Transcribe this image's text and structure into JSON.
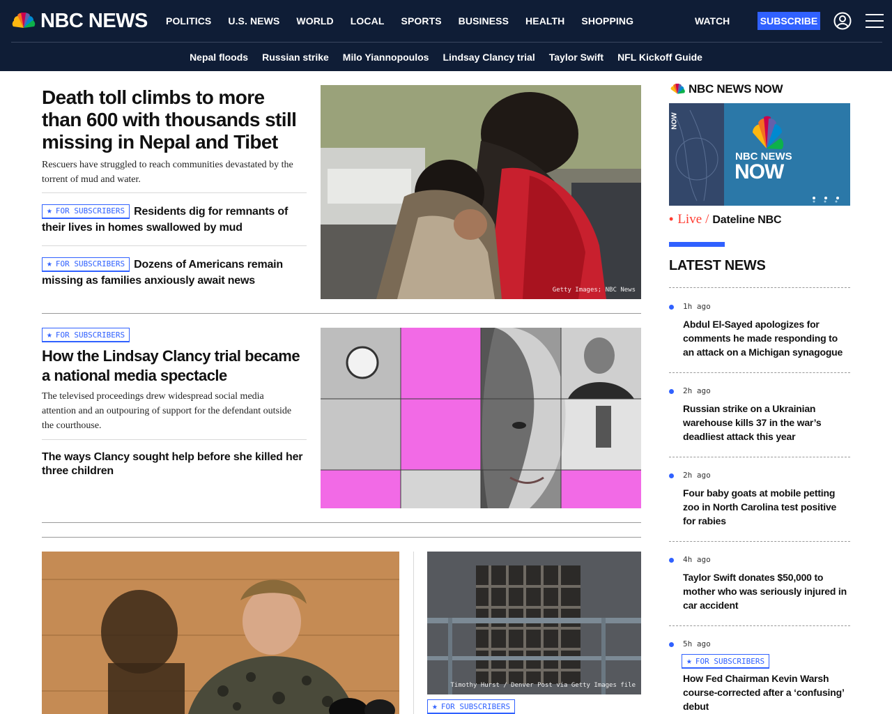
{
  "header": {
    "brand": "NBC NEWS",
    "nav": [
      "POLITICS",
      "U.S. NEWS",
      "WORLD",
      "LOCAL",
      "SPORTS",
      "BUSINESS",
      "HEALTH",
      "SHOPPING"
    ],
    "watch": "WATCH",
    "subscribe": "SUBSCRIBE",
    "trending": [
      "Nepal floods",
      "Russian strike",
      "Milo Yiannopoulos",
      "Lindsay Clancy trial",
      "Taylor Swift",
      "NFL Kickoff Guide"
    ]
  },
  "lead": {
    "headline": "Death toll climbs to more than 600 with thousands still missing in Nepal and Tibet",
    "dek": "Rescuers have struggled to reach communities devastated by the torrent of mud and water.",
    "related": [
      {
        "badge": "FOR SUBSCRIBERS",
        "text": "Residents dig for remnants of their lives in homes swallowed by mud"
      },
      {
        "badge": "FOR SUBSCRIBERS",
        "text": "Dozens of Americans remain missing as families anxiously await news"
      }
    ],
    "image_credit": "Getty Images; NBC News"
  },
  "second": {
    "badge": "FOR SUBSCRIBERS",
    "headline": "How the Lindsay Clancy trial became a national media spectacle",
    "dek": "The televised proceedings drew widespread social media attention and an outpouring of support for the defendant outside the courthouse.",
    "related": "The ways Clancy sought help before she killed her three children"
  },
  "bottom": {
    "right_credit": "Timothy Hurst / Denver Post via Getty Images file",
    "right_badge": "FOR SUBSCRIBERS"
  },
  "rail": {
    "now_logo": "NBC NEWS NOW",
    "player_logo_line1": "NBC NEWS",
    "player_logo_line2": "NOW",
    "player_side_label": "NOW",
    "live_label": "Live",
    "live_show": "Dateline NBC",
    "latest_title": "LATEST NEWS",
    "items": [
      {
        "time": "1h ago",
        "headline": "Abdul El-Sayed apologizes for comments he made responding to an attack on a Michigan synagogue"
      },
      {
        "time": "2h ago",
        "headline": "Russian strike on a Ukrainian warehouse kills 37 in the war’s deadliest attack this year"
      },
      {
        "time": "2h ago",
        "headline": "Four baby goats at mobile petting zoo in North Carolina test positive for rabies"
      },
      {
        "time": "4h ago",
        "headline": "Taylor Swift donates $50,000 to mother who was seriously injured in car accident"
      },
      {
        "time": "5h ago",
        "badge": "FOR SUBSCRIBERS",
        "headline": "How Fed Chairman Kevin Warsh course-corrected after a ‘confusing’ debut"
      }
    ]
  },
  "colors": {
    "navy": "#0f1d36",
    "accent_blue": "#3061ff",
    "live_red": "#ff3b30",
    "magenta": "#f26ae6"
  }
}
